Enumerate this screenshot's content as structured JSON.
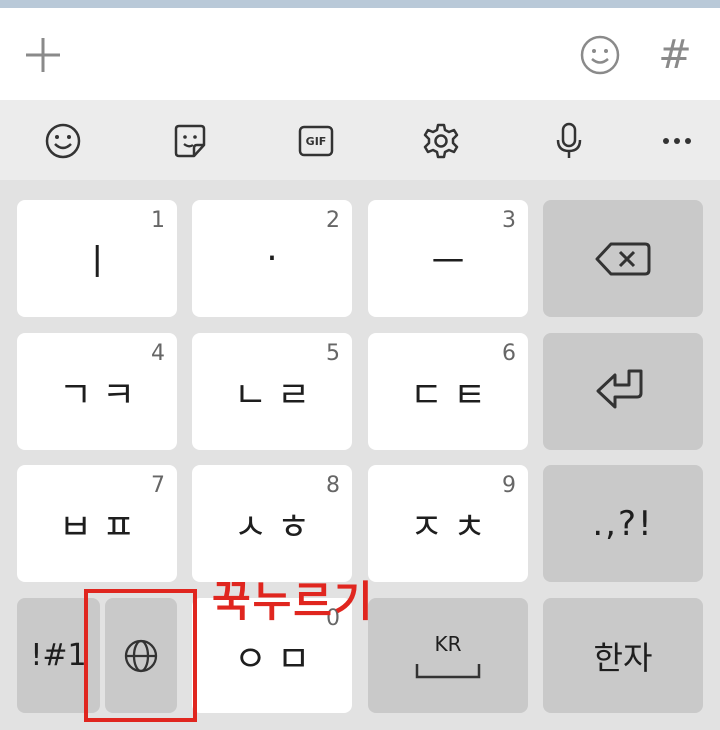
{
  "keyboard": {
    "language": "KR",
    "rows": [
      [
        {
          "label": "ㅣ",
          "num": "1"
        },
        {
          "label": "·",
          "num": "2"
        },
        {
          "label": "ㅡ",
          "num": "3"
        }
      ],
      [
        {
          "label": "ㄱㅋ",
          "num": "4"
        },
        {
          "label": "ㄴㄹ",
          "num": "5"
        },
        {
          "label": "ㄷㅌ",
          "num": "6"
        }
      ],
      [
        {
          "label": "ㅂㅍ",
          "num": "7"
        },
        {
          "label": "ㅅㅎ",
          "num": "8"
        },
        {
          "label": "ㅈㅊ",
          "num": "9"
        }
      ]
    ],
    "punct_label": ".,?!",
    "symbols_label": "!#1",
    "zero_key": {
      "label": "ㅇㅁ",
      "num": "0"
    },
    "hanja_label": "한자"
  },
  "annotation": {
    "text": "꾹누르기",
    "color": "#e0261f"
  },
  "toolbar": {
    "gif_label": "GIF"
  },
  "inputbar": {
    "hash_label": "#"
  }
}
